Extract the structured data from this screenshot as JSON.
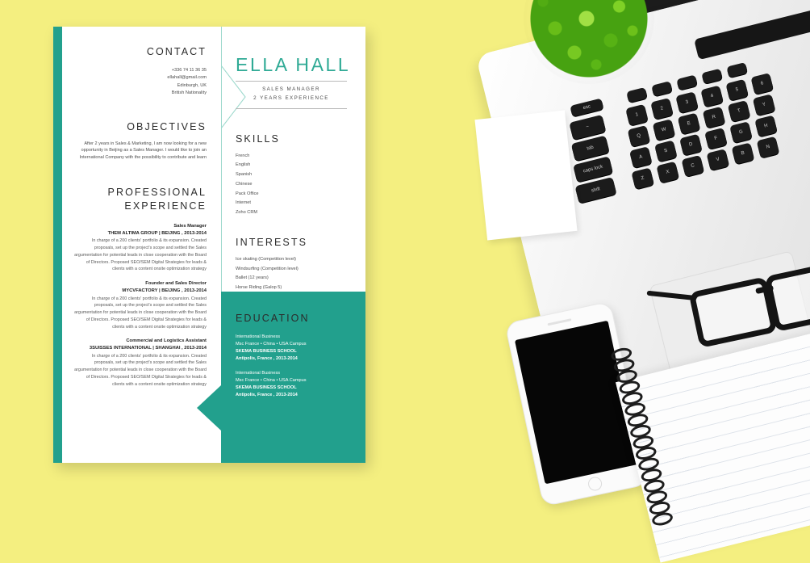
{
  "scene": {
    "background_color": "#f4ef80",
    "objects": [
      "potted-plant",
      "white-card",
      "macbook-laptop",
      "eyeglasses",
      "smartphone",
      "spiral-notebook"
    ]
  },
  "resume": {
    "accent_color": "#22a08d",
    "name": "ELLA HALL",
    "subtitle_line1": "SALES MANAGER",
    "subtitle_line2": "2 YEARS EXPERIENCE",
    "contact": {
      "heading": "CONTACT",
      "lines": [
        "+336 74 11 36 35",
        "ellahall@gmail.com",
        "Edinburgh, UK",
        "British Nationality"
      ]
    },
    "objectives": {
      "heading": "OBJECTIVES",
      "text": "After 2 years in Sales & Marketing, I am now looking for a new opportunity in Beijing as a Sales Manager. I would like to join an International Company with the possibility to contribute and learn"
    },
    "experience": {
      "heading_line1": "PROFESSIONAL",
      "heading_line2": "EXPERIENCE",
      "entries": [
        {
          "role": "Sales Manager",
          "company": "THEM ALTIMA GROUP | BEIJING , 2013-2014",
          "description": "In charge of a 200 clients' portfolio & its expansion. Created proposals, set up the project's scope and settled the Sales argumentation for potential leads in close cooperation with the Board of Directors. Proposed SEO/SEM Digital Strategies for leads & clients with a content onsite optimization strategy"
        },
        {
          "role": "Founder and Sales Director",
          "company": "MYCVFACTORY | BEIJING , 2013-2014",
          "description": "In charge of a 200 clients' portfolio & its expansion. Created proposals, set up the project's scope and settled the Sales argumentation for potential leads in close cooperation with the Board of Directors. Proposed SEO/SEM Digital Strategies for leads & clients with a content onsite optimization strategy"
        },
        {
          "role": "Commercial and Logistics Assistant",
          "company": "3SUISSES INTERNATIONAL | SHANGHAI , 2013-2014",
          "description": "In charge of a 200 clients' portfolio & its expansion. Created proposals, set up the project's scope and settled the Sales argumentation for potential leads in close cooperation with the Board of Directors. Proposed SEO/SEM Digital Strategies for leads & clients with a content onsite optimization strategy"
        }
      ]
    },
    "skills": {
      "heading": "SKILLS",
      "items": [
        "French",
        "English",
        "Spanish",
        "Chinese",
        "Pack Office",
        "Internet",
        "Zoho CRM"
      ]
    },
    "interests": {
      "heading": "INTERESTS",
      "items": [
        "Ice skating (Competition level)",
        "Windsurfing (Competition level)",
        "Ballet (12 years)",
        "Horse Riding (Galop 5)"
      ]
    },
    "education": {
      "heading": "EDUCATION",
      "entries": [
        {
          "program": "International Business",
          "campus": "Msc France • China • USA Campus",
          "school": "SKEMA BUSINESS SCHOOL",
          "location": "Antipolis, France , 2013-2014"
        },
        {
          "program": "International Business",
          "campus": "Msc France • China • USA Campus",
          "school": "SKEMA BUSINESS SCHOOL",
          "location": "Antipolis, France , 2013-2014"
        }
      ]
    }
  },
  "keyboard": {
    "labels": [
      "esc",
      "tab",
      "caps lock",
      "shift",
      "Q",
      "W",
      "E",
      "R",
      "T",
      "A",
      "S",
      "D",
      "F",
      "G",
      "Z",
      "X",
      "C",
      "V",
      "B",
      "2",
      "3",
      "4",
      "5"
    ]
  }
}
